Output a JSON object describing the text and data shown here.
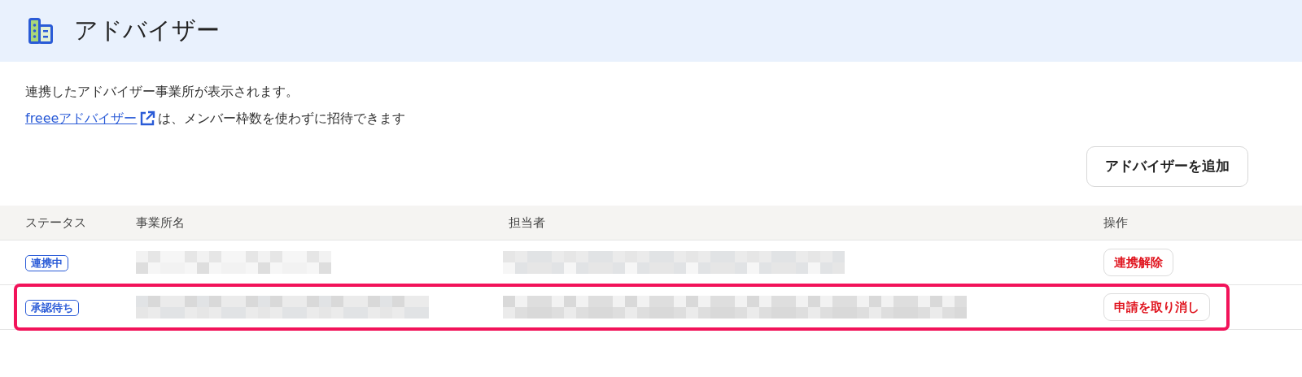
{
  "header": {
    "title": "アドバイザー"
  },
  "description": {
    "line1": "連携したアドバイザー事業所が表示されます。",
    "link": "freeeアドバイザー",
    "line2_rest": "は、メンバー枠数を使わずに招待できます"
  },
  "add_button": "アドバイザーを追加",
  "table": {
    "columns": [
      "ステータス",
      "事業所名",
      "担当者",
      "操作"
    ],
    "rows": [
      {
        "status": "連携中",
        "action": "連携解除",
        "highlighted": false
      },
      {
        "status": "承認待ち",
        "action": "申請を取り消し",
        "highlighted": true
      }
    ]
  }
}
